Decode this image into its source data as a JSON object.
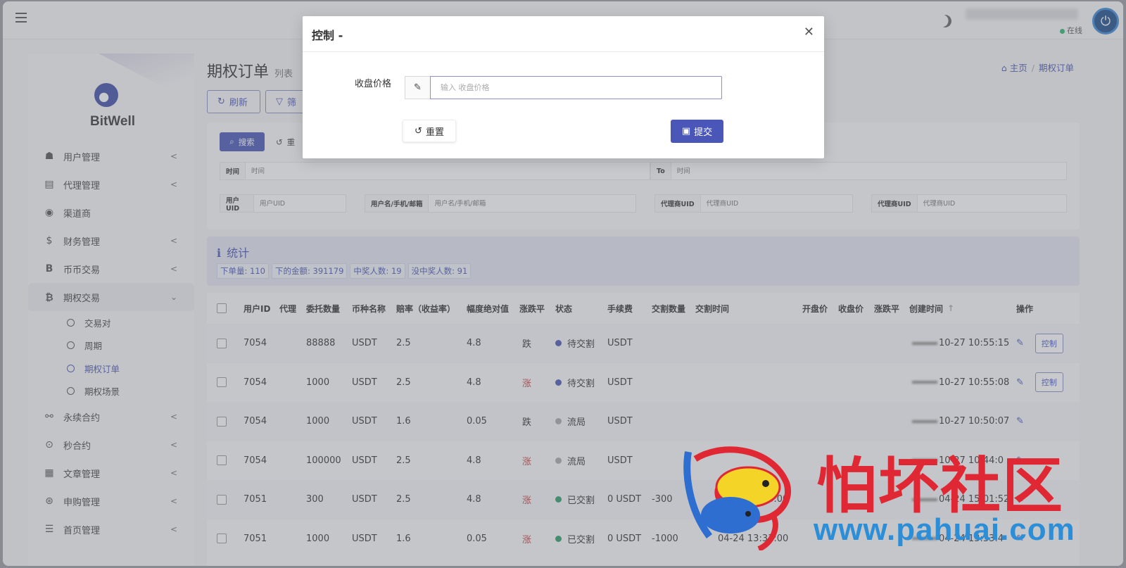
{
  "header": {
    "online_label": "在线"
  },
  "sidebar": {
    "brand": "BitWell",
    "menu": [
      {
        "label": "用户管理",
        "icon": "users-icon"
      },
      {
        "label": "代理管理",
        "icon": "id-card-icon"
      },
      {
        "label": "渠道商",
        "icon": "user-circle-icon"
      },
      {
        "label": "财务管理",
        "icon": "dollar-icon"
      },
      {
        "label": "币币交易",
        "icon": "bitcoin-b-icon"
      },
      {
        "label": "期权交易",
        "icon": "bitcoin-icon"
      },
      {
        "label": "永续合约",
        "icon": "link-icon"
      },
      {
        "label": "秒合约",
        "icon": "target-icon"
      },
      {
        "label": "文章管理",
        "icon": "newspaper-icon"
      },
      {
        "label": "申购管理",
        "icon": "lifebuoy-icon"
      },
      {
        "label": "首页管理",
        "icon": "list-icon"
      }
    ],
    "submenu": [
      "交易对",
      "周期",
      "期权订单",
      "期权场景"
    ]
  },
  "page": {
    "title": "期权订单",
    "subtitle": "列表",
    "breadcrumb_home": "主页",
    "breadcrumb_current": "期权订单",
    "refresh_label": "刷新",
    "filter_label": "筛"
  },
  "filters": {
    "search_label": "搜索",
    "reset_label": "重",
    "time_label": "时间",
    "time_placeholder": "时间",
    "to_label": "To",
    "to_placeholder": "时间",
    "uid_label": "用户UID",
    "uid_placeholder": "用户UID",
    "name_label": "用户名/手机/邮箱",
    "name_placeholder": "用户名/手机/邮箱",
    "agent_label": "代理商UID",
    "agent_placeholder": "代理商UID",
    "agent2_label": "代理商UID",
    "agent2_placeholder": "代理商UID"
  },
  "stats": {
    "title": "统计",
    "chips": [
      "下单量: 110",
      "下的金额: 391179",
      "中奖人数: 19",
      "没中奖人数: 91"
    ]
  },
  "table": {
    "headers": [
      "用户ID",
      "代理",
      "委托数量",
      "币种名称",
      "赔率（收益率）",
      "幅度绝对值",
      "涨跌平",
      "状态",
      "手续费",
      "交割数量",
      "交割时间",
      "开盘价",
      "收盘价",
      "涨跌平",
      "创建时间",
      "操作"
    ],
    "rows": [
      {
        "uid": "7054",
        "qty": "88888",
        "coin": "USDT",
        "rate": "2.5",
        "amp": "4.8",
        "dir": "跌",
        "status": "待交割",
        "status_color": "#4a57b8",
        "fee": "USDT",
        "dqty": "",
        "dtime": "",
        "ctime": "10-27 10:55:15",
        "control": "控制"
      },
      {
        "uid": "7054",
        "qty": "1000",
        "coin": "USDT",
        "rate": "2.5",
        "amp": "4.8",
        "dir": "涨",
        "status": "待交割",
        "status_color": "#4a57b8",
        "fee": "USDT",
        "dqty": "",
        "dtime": "",
        "ctime": "10-27 10:55:08",
        "control": "控制"
      },
      {
        "uid": "7054",
        "qty": "1000",
        "coin": "USDT",
        "rate": "1.6",
        "amp": "0.05",
        "dir": "跌",
        "status": "流局",
        "status_color": "#aaaaaa",
        "fee": "USDT",
        "dqty": "",
        "dtime": "",
        "ctime": "10-27 10:50:07",
        "control": ""
      },
      {
        "uid": "7054",
        "qty": "100000",
        "coin": "USDT",
        "rate": "2.5",
        "amp": "4.8",
        "dir": "涨",
        "status": "流局",
        "status_color": "#aaaaaa",
        "fee": "USDT",
        "dqty": "",
        "dtime": "",
        "ctime": "10-27 10:44:0",
        "control": ""
      },
      {
        "uid": "7051",
        "qty": "300",
        "coin": "USDT",
        "rate": "2.5",
        "amp": "4.8",
        "dir": "涨",
        "status": "已交割",
        "status_color": "#2e9e6a",
        "fee": "0 USDT",
        "dqty": "-300",
        "dtime": "04-24 13:03:00",
        "ctime": "04-24 15:01:52",
        "control": ""
      },
      {
        "uid": "7051",
        "qty": "1000",
        "coin": "USDT",
        "rate": "1.6",
        "amp": "0.05",
        "dir": "涨",
        "status": "已交割",
        "status_color": "#2e9e6a",
        "fee": "0 USDT",
        "dqty": "-1000",
        "dtime": "04-24 13:33:00",
        "ctime": "04-24 13:33:4",
        "control": ""
      }
    ]
  },
  "modal": {
    "title": "控制 -",
    "field_label": "收盘价格",
    "input_placeholder": "输入 收盘价格",
    "reset_label": "重置",
    "submit_label": "提交"
  },
  "watermark": {
    "text": "怕坏社区",
    "url": "www.pahuai.com"
  },
  "colors": {
    "accent": "#4a57b8",
    "up": "#d43a3a",
    "watermark_red": "#e02835",
    "watermark_blue": "#2d8ed8"
  }
}
